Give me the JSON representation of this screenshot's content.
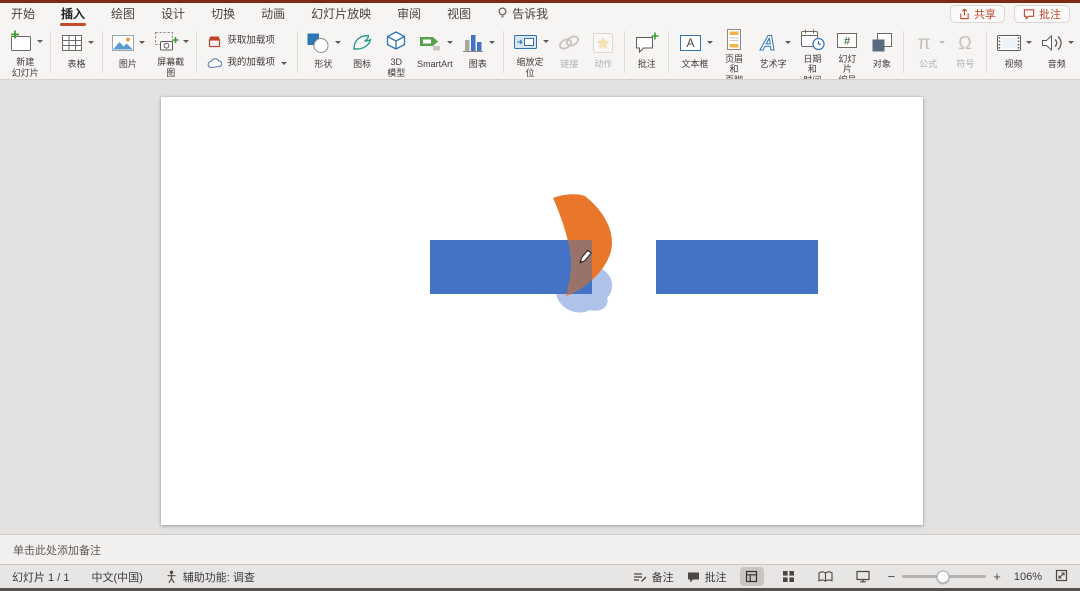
{
  "menubar": {
    "tabs": [
      {
        "label": "开始"
      },
      {
        "label": "插入",
        "active": true
      },
      {
        "label": "绘图"
      },
      {
        "label": "设计"
      },
      {
        "label": "切换"
      },
      {
        "label": "动画"
      },
      {
        "label": "幻灯片放映"
      },
      {
        "label": "审阅"
      },
      {
        "label": "视图"
      },
      {
        "label": "告诉我"
      }
    ],
    "share_label": "共享",
    "comments_label": "批注"
  },
  "ribbon": {
    "buttons": [
      {
        "label": "新建\n幻灯片",
        "dropdown": true
      },
      {
        "label": "表格",
        "dropdown": true
      },
      {
        "label": "图片",
        "dropdown": true
      },
      {
        "label": "屏幕截图",
        "dropdown": true
      },
      {
        "label": "获取加载项"
      },
      {
        "label": "我的加载项",
        "dropdown": true
      },
      {
        "label": "形状",
        "dropdown": true
      },
      {
        "label": "图标"
      },
      {
        "label": "3D\n模型"
      },
      {
        "label": "SmartArt",
        "dropdown": true
      },
      {
        "label": "图表",
        "dropdown": true
      },
      {
        "label": "缩放定位",
        "dropdown": true
      },
      {
        "label": "链接",
        "disabled": true
      },
      {
        "label": "动作",
        "disabled": true
      },
      {
        "label": "批注"
      },
      {
        "label": "文本框",
        "dropdown": true
      },
      {
        "label": "页眉和\n页脚"
      },
      {
        "label": "艺术字",
        "dropdown": true
      },
      {
        "label": "日期和\n时间"
      },
      {
        "label": "幻灯片\n编号"
      },
      {
        "label": "对象"
      },
      {
        "label": "公式",
        "dropdown": true,
        "disabled": true
      },
      {
        "label": "符号",
        "disabled": true
      },
      {
        "label": "视频",
        "dropdown": true
      },
      {
        "label": "音频",
        "dropdown": true
      }
    ]
  },
  "slide": {
    "colors": {
      "rect_blue": "#4472C4",
      "ink_orange": "#E8772B",
      "ink_light_blue": "#A6BCE8"
    },
    "shapes": [
      "left-blue-rectangle",
      "right-blue-rectangle",
      "orange-ink-swoosh",
      "light-blue-ink-blob",
      "pen-cursor"
    ]
  },
  "notes": {
    "placeholder": "单击此处添加备注"
  },
  "statusbar": {
    "slide_counter": "幻灯片 1 / 1",
    "language": "中文(中国)",
    "accessibility": "辅助功能: 调查",
    "notes_label": "备注",
    "comments_label": "批注",
    "zoom_level": "106%"
  }
}
